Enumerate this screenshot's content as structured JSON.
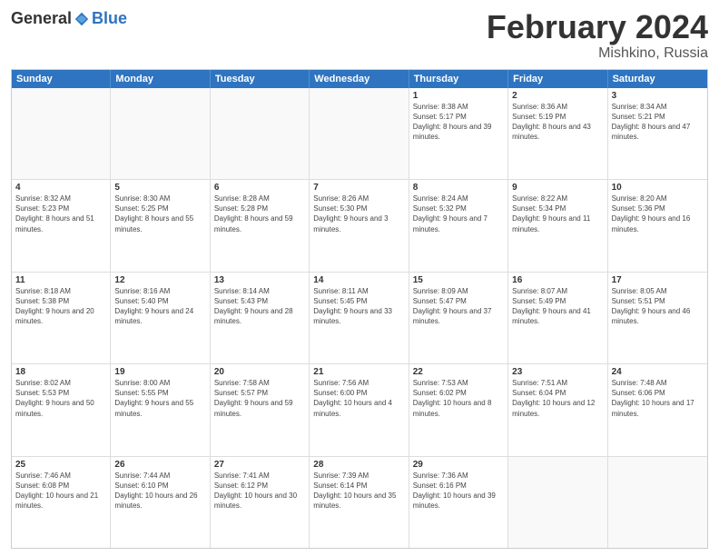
{
  "logo": {
    "general": "General",
    "blue": "Blue"
  },
  "header": {
    "title": "February 2024",
    "subtitle": "Mishkino, Russia"
  },
  "days": [
    "Sunday",
    "Monday",
    "Tuesday",
    "Wednesday",
    "Thursday",
    "Friday",
    "Saturday"
  ],
  "weeks": [
    [
      {
        "day": "",
        "info": ""
      },
      {
        "day": "",
        "info": ""
      },
      {
        "day": "",
        "info": ""
      },
      {
        "day": "",
        "info": ""
      },
      {
        "day": "1",
        "info": "Sunrise: 8:38 AM\nSunset: 5:17 PM\nDaylight: 8 hours and 39 minutes."
      },
      {
        "day": "2",
        "info": "Sunrise: 8:36 AM\nSunset: 5:19 PM\nDaylight: 8 hours and 43 minutes."
      },
      {
        "day": "3",
        "info": "Sunrise: 8:34 AM\nSunset: 5:21 PM\nDaylight: 8 hours and 47 minutes."
      }
    ],
    [
      {
        "day": "4",
        "info": "Sunrise: 8:32 AM\nSunset: 5:23 PM\nDaylight: 8 hours and 51 minutes."
      },
      {
        "day": "5",
        "info": "Sunrise: 8:30 AM\nSunset: 5:25 PM\nDaylight: 8 hours and 55 minutes."
      },
      {
        "day": "6",
        "info": "Sunrise: 8:28 AM\nSunset: 5:28 PM\nDaylight: 8 hours and 59 minutes."
      },
      {
        "day": "7",
        "info": "Sunrise: 8:26 AM\nSunset: 5:30 PM\nDaylight: 9 hours and 3 minutes."
      },
      {
        "day": "8",
        "info": "Sunrise: 8:24 AM\nSunset: 5:32 PM\nDaylight: 9 hours and 7 minutes."
      },
      {
        "day": "9",
        "info": "Sunrise: 8:22 AM\nSunset: 5:34 PM\nDaylight: 9 hours and 11 minutes."
      },
      {
        "day": "10",
        "info": "Sunrise: 8:20 AM\nSunset: 5:36 PM\nDaylight: 9 hours and 16 minutes."
      }
    ],
    [
      {
        "day": "11",
        "info": "Sunrise: 8:18 AM\nSunset: 5:38 PM\nDaylight: 9 hours and 20 minutes."
      },
      {
        "day": "12",
        "info": "Sunrise: 8:16 AM\nSunset: 5:40 PM\nDaylight: 9 hours and 24 minutes."
      },
      {
        "day": "13",
        "info": "Sunrise: 8:14 AM\nSunset: 5:43 PM\nDaylight: 9 hours and 28 minutes."
      },
      {
        "day": "14",
        "info": "Sunrise: 8:11 AM\nSunset: 5:45 PM\nDaylight: 9 hours and 33 minutes."
      },
      {
        "day": "15",
        "info": "Sunrise: 8:09 AM\nSunset: 5:47 PM\nDaylight: 9 hours and 37 minutes."
      },
      {
        "day": "16",
        "info": "Sunrise: 8:07 AM\nSunset: 5:49 PM\nDaylight: 9 hours and 41 minutes."
      },
      {
        "day": "17",
        "info": "Sunrise: 8:05 AM\nSunset: 5:51 PM\nDaylight: 9 hours and 46 minutes."
      }
    ],
    [
      {
        "day": "18",
        "info": "Sunrise: 8:02 AM\nSunset: 5:53 PM\nDaylight: 9 hours and 50 minutes."
      },
      {
        "day": "19",
        "info": "Sunrise: 8:00 AM\nSunset: 5:55 PM\nDaylight: 9 hours and 55 minutes."
      },
      {
        "day": "20",
        "info": "Sunrise: 7:58 AM\nSunset: 5:57 PM\nDaylight: 9 hours and 59 minutes."
      },
      {
        "day": "21",
        "info": "Sunrise: 7:56 AM\nSunset: 6:00 PM\nDaylight: 10 hours and 4 minutes."
      },
      {
        "day": "22",
        "info": "Sunrise: 7:53 AM\nSunset: 6:02 PM\nDaylight: 10 hours and 8 minutes."
      },
      {
        "day": "23",
        "info": "Sunrise: 7:51 AM\nSunset: 6:04 PM\nDaylight: 10 hours and 12 minutes."
      },
      {
        "day": "24",
        "info": "Sunrise: 7:48 AM\nSunset: 6:06 PM\nDaylight: 10 hours and 17 minutes."
      }
    ],
    [
      {
        "day": "25",
        "info": "Sunrise: 7:46 AM\nSunset: 6:08 PM\nDaylight: 10 hours and 21 minutes."
      },
      {
        "day": "26",
        "info": "Sunrise: 7:44 AM\nSunset: 6:10 PM\nDaylight: 10 hours and 26 minutes."
      },
      {
        "day": "27",
        "info": "Sunrise: 7:41 AM\nSunset: 6:12 PM\nDaylight: 10 hours and 30 minutes."
      },
      {
        "day": "28",
        "info": "Sunrise: 7:39 AM\nSunset: 6:14 PM\nDaylight: 10 hours and 35 minutes."
      },
      {
        "day": "29",
        "info": "Sunrise: 7:36 AM\nSunset: 6:16 PM\nDaylight: 10 hours and 39 minutes."
      },
      {
        "day": "",
        "info": ""
      },
      {
        "day": "",
        "info": ""
      }
    ]
  ]
}
